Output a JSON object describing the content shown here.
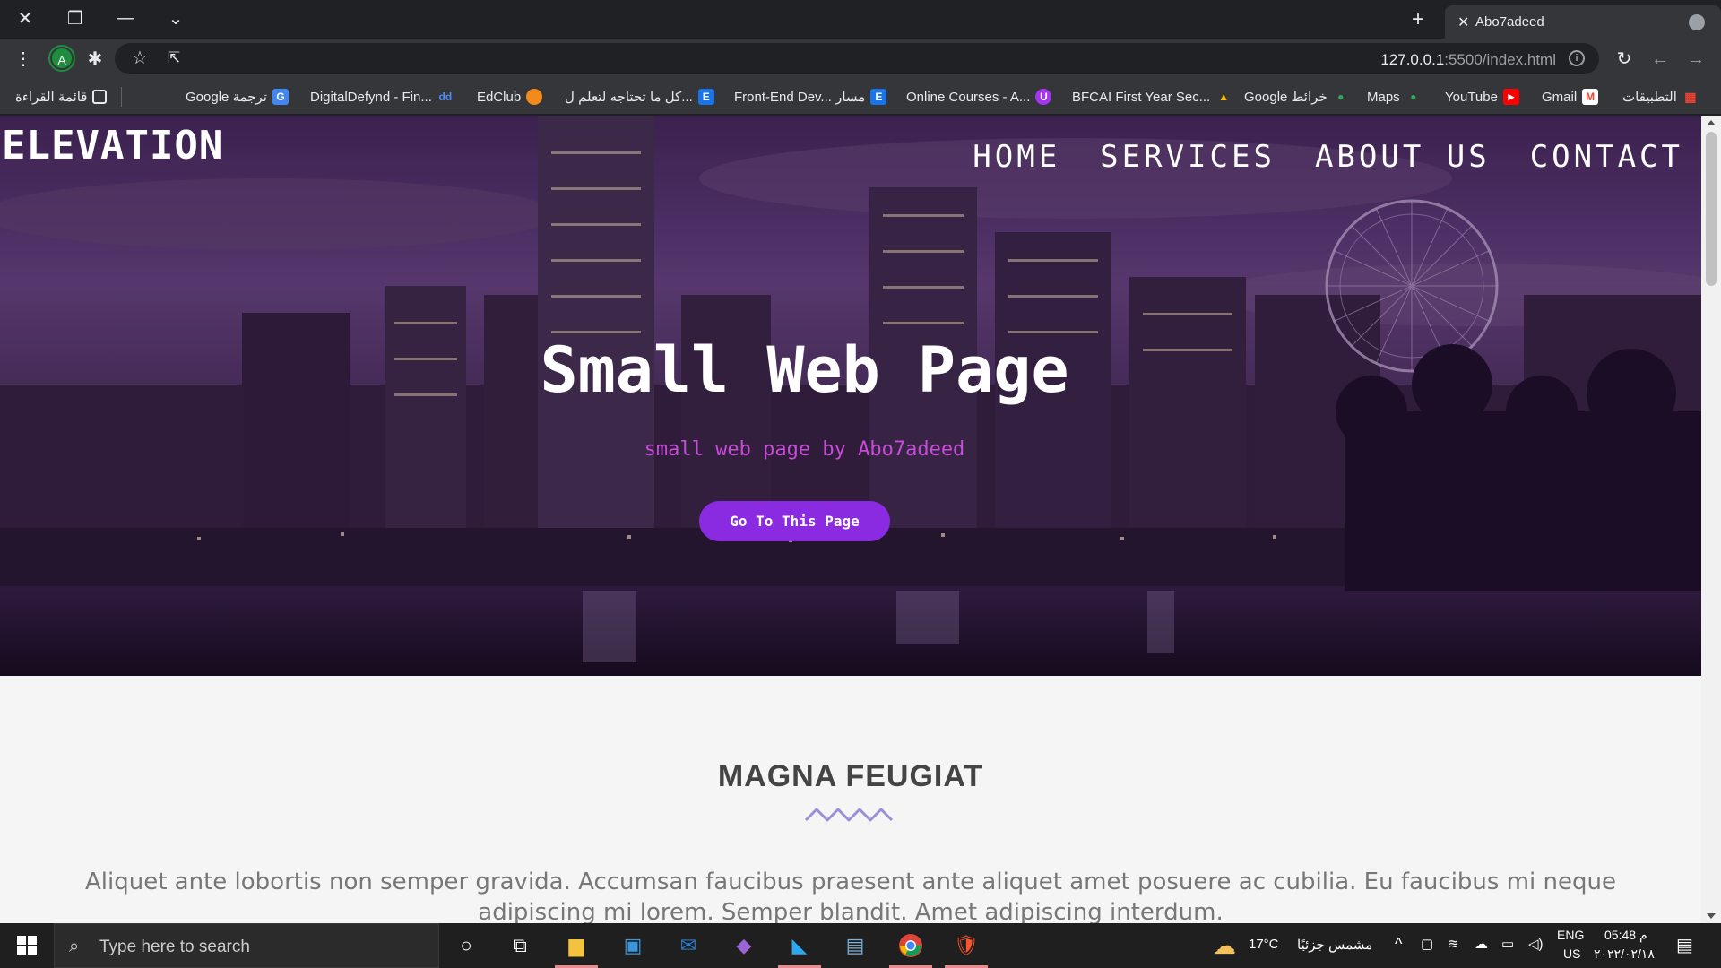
{
  "browser": {
    "tab_title": "Abo7adeed",
    "tab_close": "✕",
    "new_tab": "+",
    "url_host": "127.0.0.1",
    "url_path": ":5500/index.html",
    "profile_initial": "A",
    "bookmarks": [
      {
        "label": "التطبيقات",
        "icon": "apps-grid-icon"
      },
      {
        "label": "Gmail",
        "icon": "gmail-icon"
      },
      {
        "label": "YouTube",
        "icon": "youtube-icon"
      },
      {
        "label": "Maps",
        "icon": "maps-icon"
      },
      {
        "label": "Google خرائط",
        "icon": "maps-icon"
      },
      {
        "label": "BFCAI First Year Sec...",
        "icon": "drive-icon"
      },
      {
        "label": "Online Courses - A...",
        "icon": "udemy-icon"
      },
      {
        "label": "Front-End Dev... مسار",
        "icon": "e-icon"
      },
      {
        "label": "كل ما تحتاجه لتعلم ل...",
        "icon": "e-icon"
      },
      {
        "label": "EdClub",
        "icon": "edclub-icon"
      },
      {
        "label": "DigitalDefynd - Fin...",
        "icon": "dd-icon"
      },
      {
        "label": "Google ترجمة",
        "icon": "translate-icon"
      }
    ],
    "reading_list": "قائمة القراءة"
  },
  "page": {
    "logo": "ELEVATION",
    "nav": [
      "HOME",
      "SERVICES",
      "ABOUT US",
      "CONTACT"
    ],
    "hero_title": "Small Web Page",
    "hero_subtitle": "small web page by Abo7adeed",
    "hero_button": "Go To This Page",
    "section_title": "MAGNA FEUGIAT",
    "section_text": "Aliquet ante lobortis non semper gravida. Accumsan faucibus praesent ante aliquet amet posuere ac cubilia. Eu faucibus mi neque adipiscing mi lorem. Semper blandit. Amet adipiscing interdum."
  },
  "taskbar": {
    "search_placeholder": "Type here to search",
    "weather_temp": "17°C",
    "weather_text": "مشمس جزئيًا",
    "lang_top": "ENG",
    "lang_bottom": "US",
    "time": "05:48 م",
    "date": "٢٠٢٢/٠٢/١٨"
  },
  "colors": {
    "accent": "#8a2be2",
    "subtitle": "#c94bd9",
    "wave": "#9b8fd8"
  }
}
